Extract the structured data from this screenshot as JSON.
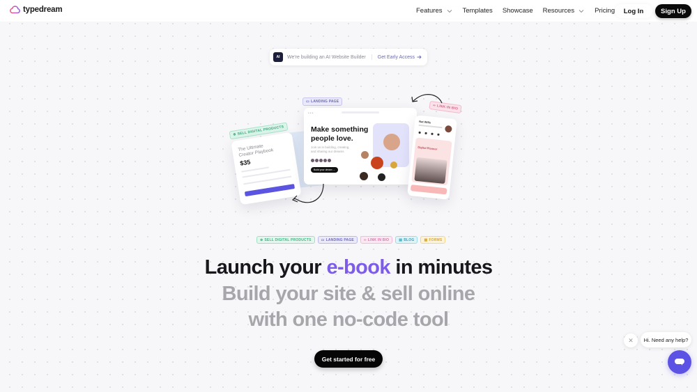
{
  "header": {
    "brand": "typedream",
    "nav": [
      {
        "label": "Features",
        "has_dropdown": true
      },
      {
        "label": "Templates",
        "has_dropdown": false
      },
      {
        "label": "Showcase",
        "has_dropdown": false
      },
      {
        "label": "Resources",
        "has_dropdown": true
      },
      {
        "label": "Pricing",
        "has_dropdown": false
      }
    ],
    "login_label": "Log In",
    "signup_label": "Sign Up"
  },
  "announcement": {
    "badge": "AI",
    "message": "We're building an AI Website Builder",
    "cta": "Get Early Access",
    "cta_icon": "arrow-right-icon"
  },
  "hero_collage": {
    "sell_card": {
      "tag": "SELL DIGITAL PRODUCTS",
      "title": "The Ultimate Creator Playbook",
      "price": "$35"
    },
    "landing_card": {
      "tag": "LANDING PAGE",
      "headline": "Make something people love.",
      "subtext": "Join us in building, creating, and sharing our dreams",
      "button": "Build your dream →"
    },
    "bio_card": {
      "tag": "LINK IN BIO",
      "name": "Nat Wills",
      "panel_title": "Digital Planner"
    }
  },
  "chips": [
    {
      "label": "SELL DIGITAL PRODUCTS",
      "icon": "dollar-circle-icon",
      "color": "#3fb58a",
      "bg": "#e3f7ee"
    },
    {
      "label": "LANDING PAGE",
      "icon": "browser-icon",
      "color": "#6e6ab8",
      "bg": "#ebeafb"
    },
    {
      "label": "LINK IN BIO",
      "icon": "link-icon",
      "color": "#d77ab0",
      "bg": "#fbe8f3"
    },
    {
      "label": "BLOG",
      "icon": "document-icon",
      "color": "#2fa8c0",
      "bg": "#dff4f8"
    },
    {
      "label": "FORMS",
      "icon": "form-icon",
      "color": "#d9a72f",
      "bg": "#fdf3d8"
    }
  ],
  "hero": {
    "headline_prefix": "Launch your ",
    "headline_accent": "e-book",
    "headline_suffix": " in minutes",
    "subline_1": "Build your site & sell online",
    "subline_2": "with one no-code tool",
    "cta_label": "Get started for free"
  },
  "chat_widget": {
    "message": "Hi. Need any help?",
    "close_icon": "close-icon",
    "launcher_icon": "chat-bubble-icon"
  },
  "colors": {
    "accent": "#7d5ce8",
    "chat": "#5c53e5",
    "primary_button": "#060606"
  }
}
